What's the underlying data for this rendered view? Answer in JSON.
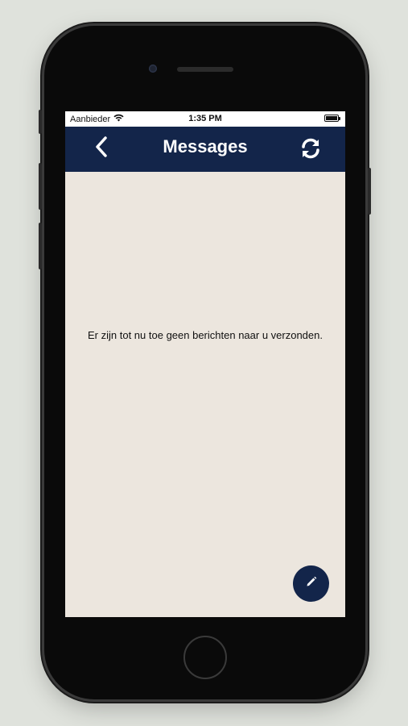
{
  "status_bar": {
    "carrier": "Aanbieder",
    "time": "1:35 PM"
  },
  "header": {
    "title": "Messages"
  },
  "main": {
    "empty_message": "Er zijn tot nu toe geen berichten naar u verzonden."
  },
  "colors": {
    "navbar": "#13254a",
    "content_background": "#ece6de",
    "fab": "#13254a"
  },
  "icons": {
    "back": "chevron-left-icon",
    "refresh": "refresh-icon",
    "compose": "pencil-icon",
    "wifi": "wifi-icon",
    "battery": "battery-icon"
  }
}
